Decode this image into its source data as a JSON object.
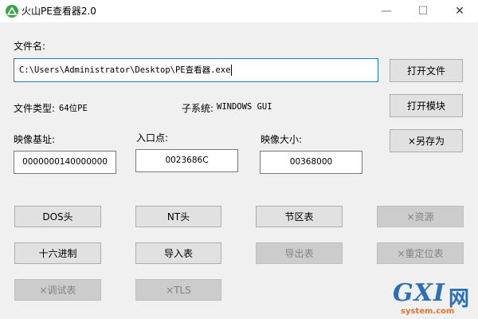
{
  "window": {
    "title": "火山PE查看器2.0",
    "minimize_glyph": "—",
    "maximize_glyph": "☐",
    "close_glyph": "✕"
  },
  "icons": {
    "app": "volcano-app-icon"
  },
  "file": {
    "label": "文件名:",
    "path": "C:\\Users\\Administrator\\Desktop\\PE查看器.exe"
  },
  "info": {
    "file_type_label": "文件类型:",
    "file_type_value": "64位PE",
    "subsystem_label": "子系统:",
    "subsystem_value": "WINDOWS GUI"
  },
  "fields": {
    "image_base_label": "映像基址:",
    "image_base_value": "0000000140000000",
    "entry_point_label": "入口点:",
    "entry_point_value": "0023686C",
    "image_size_label": "映像大小:",
    "image_size_value": "00368000"
  },
  "buttons": {
    "open_file": "打开文件",
    "open_module": "打开模块",
    "save_as": "×另存为",
    "dos_header": "DOS头",
    "nt_header": "NT头",
    "section_table": "节区表",
    "resources": "×资源",
    "hex": "十六进制",
    "import_table": "导入表",
    "export_table": "导出表",
    "relocation": "×重定位表",
    "debug_table": "×调试表",
    "tls": "×TLS"
  },
  "watermark": {
    "logo": "GXI",
    "cn": "网",
    "site": "system.com"
  },
  "colors": {
    "input_border": "#1979ca",
    "button_bg": "#e1e1e1",
    "button_disabled_bg": "#cccccc",
    "app_icon": "#3aa24a"
  }
}
